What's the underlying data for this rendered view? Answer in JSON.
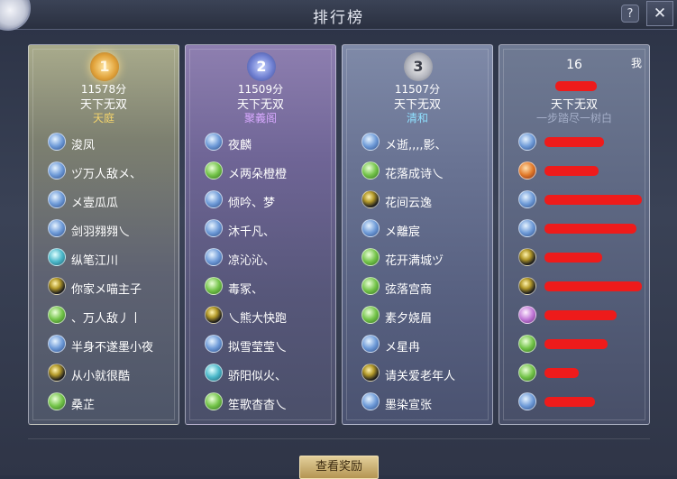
{
  "window": {
    "title": "排行榜"
  },
  "controls": {
    "help_label": "?",
    "close_label": "✕"
  },
  "cards": [
    {
      "rank": "1",
      "score": "11578分",
      "title": "天下无双",
      "guild": "天庭",
      "badge": "rank-1-badge",
      "color": "#f3d36b",
      "players": [
        {
          "name": "浚凤",
          "icon": "blue-class-icon"
        },
        {
          "name": "ヅ万人敌メ、",
          "icon": "blue-class-icon"
        },
        {
          "name": "メ壹瓜瓜",
          "icon": "blue-class-icon"
        },
        {
          "name": "剑羽翙翙乀",
          "icon": "blue-class-icon"
        },
        {
          "name": "纵笔江川",
          "icon": "cyan-class-icon"
        },
        {
          "name": "你家メ喵主子",
          "icon": "dark-class-icon"
        },
        {
          "name": "、万人敌丿丨",
          "icon": "green-class-icon"
        },
        {
          "name": "半身不遂墨小夜",
          "icon": "blue-class-icon"
        },
        {
          "name": "从小就很酷",
          "icon": "dark-class-icon"
        },
        {
          "name": "桑芷",
          "icon": "green-class-icon"
        }
      ]
    },
    {
      "rank": "2",
      "score": "11509分",
      "title": "天下无双",
      "guild": "聚義阁",
      "badge": "rank-2-badge",
      "color": "#d8a9ff",
      "players": [
        {
          "name": "夜麟",
          "icon": "blue-class-icon"
        },
        {
          "name": "メ两朵橙橙",
          "icon": "green-class-icon"
        },
        {
          "name": "倾吟、梦",
          "icon": "blue-class-icon"
        },
        {
          "name": "沐千凡、",
          "icon": "blue-class-icon"
        },
        {
          "name": "凉沁沁、",
          "icon": "blue-class-icon"
        },
        {
          "name": "毒冢、",
          "icon": "green-class-icon"
        },
        {
          "name": "乀熊大快跑",
          "icon": "dark-class-icon"
        },
        {
          "name": "拟雪莹莹乀",
          "icon": "blue-class-icon"
        },
        {
          "name": "骄阳似火、",
          "icon": "cyan-class-icon"
        },
        {
          "name": "笙歌杳杳乀",
          "icon": "green-class-icon"
        }
      ]
    },
    {
      "rank": "3",
      "score": "11507分",
      "title": "天下无双",
      "guild": "清和",
      "badge": "rank-3-badge",
      "color": "#8fe0ff",
      "players": [
        {
          "name": "メ逝,,,,影、",
          "icon": "blue-class-icon"
        },
        {
          "name": "花落成诗乀",
          "icon": "green-class-icon"
        },
        {
          "name": "花间云逸",
          "icon": "dark-class-icon"
        },
        {
          "name": "メ離宸",
          "icon": "blue-class-icon"
        },
        {
          "name": "花开满城ヅ",
          "icon": "green-class-icon"
        },
        {
          "name": "弦落宫商",
          "icon": "green-class-icon"
        },
        {
          "name": "素夕娆眉",
          "icon": "green-class-icon"
        },
        {
          "name": "メ星冉",
          "icon": "blue-class-icon"
        },
        {
          "name": "请关爱老年人",
          "icon": "dark-class-icon"
        },
        {
          "name": "墨染宣张",
          "icon": "blue-class-icon"
        }
      ]
    },
    {
      "rank": "16",
      "my_label": "我",
      "title": "天下无双",
      "guild": "一步踏尽一树白",
      "color": "#a4aec8",
      "players": [
        {
          "icon": "blue-class-icon",
          "redacted": true
        },
        {
          "icon": "orange-class-icon",
          "redacted": true
        },
        {
          "icon": "blue-class-icon",
          "redacted": true
        },
        {
          "icon": "blue-class-icon",
          "redacted": true
        },
        {
          "icon": "dark-class-icon",
          "redacted": true
        },
        {
          "icon": "dark-class-icon",
          "redacted": true
        },
        {
          "icon": "pink-class-icon",
          "redacted": true
        },
        {
          "icon": "green-class-icon",
          "redacted": true
        },
        {
          "icon": "green-class-icon",
          "redacted": true
        },
        {
          "icon": "blue-class-icon",
          "redacted": true
        }
      ]
    }
  ],
  "footer": {
    "reward_button": "查看奖励"
  }
}
